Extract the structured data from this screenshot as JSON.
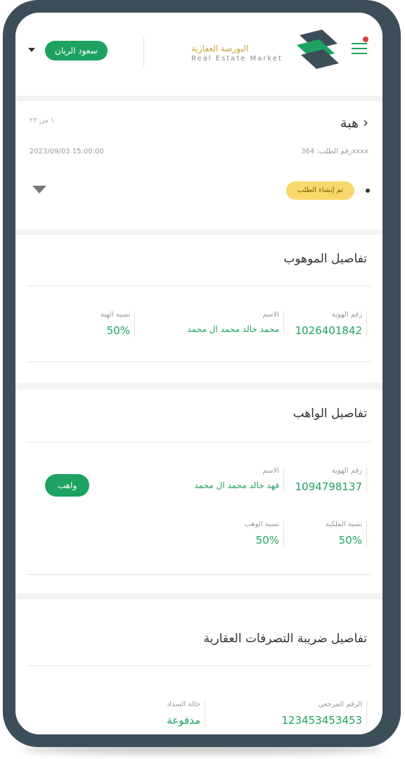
{
  "header": {
    "user_name": "سعود الريان",
    "brand_ar": "البورصة العقارية",
    "brand_en": "Real Estate Market"
  },
  "request": {
    "title": "هبة",
    "since": "١ من ٢٣",
    "request_number": "رقم الطلب: 364xxxx",
    "datetime": "2023/09/03 15:00:00",
    "status": "تم إنشاء الطلب"
  },
  "gift_receiver": {
    "section_title": "تفاصيل الموهوب",
    "id_label": "رقم الهوية",
    "id_value": "1026401842",
    "name_label": "الاسم",
    "name_value": "محمد خالد محمد ال محمد",
    "share_label": "نسبة الهبة",
    "share_value": "50%"
  },
  "gift_giver": {
    "section_title": "تفاصيل الواهب",
    "id_label": "رقم الهوية",
    "id_value": "1094798137",
    "name_label": "الاسم",
    "name_value": "فهد خالد محمد ال محمد",
    "ownership_label": "نسبة الملكية",
    "ownership_value": "50%",
    "gift_share_label": "نسبة الوهب",
    "gift_share_value": "50%",
    "role_label": "واهب"
  },
  "tax": {
    "section_title": "تفاصيل ضريبة التصرفات العقارية",
    "ref_label": "الرقم المرجعي",
    "ref_value": "123453453453",
    "status_label": "حالة السداد",
    "status_value": "مدفوعة"
  },
  "colors": {
    "accent": "#1da261",
    "frame": "#3d4e5b",
    "badge": "#f8d86a"
  }
}
